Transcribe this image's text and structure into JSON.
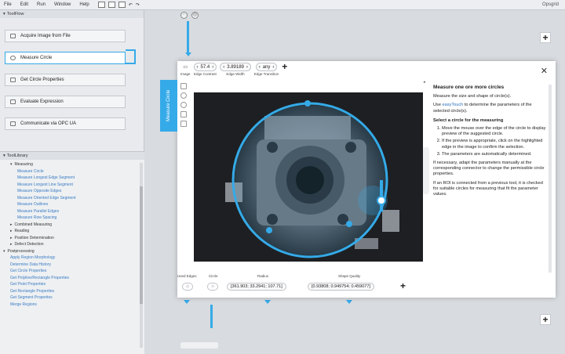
{
  "menu": {
    "items": [
      "File",
      "Edit",
      "Run",
      "Window",
      "Help"
    ],
    "brand": "Opsgrid"
  },
  "toolflow": {
    "title": "ToolFlow",
    "steps": [
      "Acquire Image from File",
      "Measure Circle",
      "Get Circle Properties",
      "Evaluate Expression",
      "Communicate via OPC UA"
    ]
  },
  "toollib": {
    "title": "ToolLibrary",
    "items": [
      {
        "label": "Measuring",
        "level": 1,
        "expander": "▾",
        "link": false
      },
      {
        "label": "Measure Circle",
        "level": 2,
        "link": true
      },
      {
        "label": "Measure Longest Edge Segment",
        "level": 2,
        "link": true
      },
      {
        "label": "Measure Longest Line Segment",
        "level": 2,
        "link": true
      },
      {
        "label": "Measure Opposite Edges",
        "level": 2,
        "link": true
      },
      {
        "label": "Measure Oriented Edge Segment",
        "level": 2,
        "link": true
      },
      {
        "label": "Measure Outlines",
        "level": 2,
        "link": true
      },
      {
        "label": "Measure Parallel Edges",
        "level": 2,
        "link": true
      },
      {
        "label": "Measure Row Spacing",
        "level": 2,
        "link": true
      },
      {
        "label": "Combined Measuring",
        "level": 1,
        "expander": "▸",
        "link": false
      },
      {
        "label": "Reading",
        "level": 1,
        "expander": "▸",
        "link": false
      },
      {
        "label": "Position Determination",
        "level": 1,
        "expander": "▸",
        "link": false
      },
      {
        "label": "Defect Detection",
        "level": 1,
        "expander": "▸",
        "link": false
      },
      {
        "label": "Postprocessing",
        "level": 0,
        "expander": "▾",
        "link": false
      },
      {
        "label": "Apply Region Morphology",
        "level": 1,
        "link": true
      },
      {
        "label": "Determine Data History",
        "level": 1,
        "link": true
      },
      {
        "label": "Get Circle Properties",
        "level": 1,
        "link": true
      },
      {
        "label": "Get Polyline/Rectangle Properties",
        "level": 1,
        "link": true
      },
      {
        "label": "Get Point Properties",
        "level": 1,
        "link": true
      },
      {
        "label": "Get Rectangle Properties",
        "level": 1,
        "link": true
      },
      {
        "label": "Get Segment Properties",
        "level": 1,
        "link": true
      },
      {
        "label": "Merge Regions",
        "level": 1,
        "link": true
      }
    ]
  },
  "dialog": {
    "side_tab": "Measure Circle",
    "params": [
      {
        "value": "57.4",
        "label": "Edge Contrast"
      },
      {
        "value": "3.89189",
        "label": "Edge Width"
      },
      {
        "value": "any",
        "label": "Edge Transition"
      }
    ],
    "image_label": "Image",
    "help": {
      "title": "Measure one ore more circles",
      "p1": "Measure the size and shape of circle(s).",
      "p2_pre": "Use ",
      "p2_link": "easyTouch",
      "p2_post": " to determine the parameters of the selected circle(s).",
      "subtitle": "Select a circle for the measuring",
      "steps": [
        "Move the mouse over the edge of the circle to display preview of the suggested circle.",
        "If the preview is appropriate, click on the highlighted edge in the image to confirm the selection.",
        "The parameters are automatically determined."
      ],
      "p3": "If necessary, adapt the parameters manually at the corresponding connector to change the permissible circle properties.",
      "p4": "If an ROI is connected from a previous tool, it is checked for suitable circles for measuring that fit the parameter values."
    },
    "bottom": {
      "labels": [
        "Used Edges",
        "Circle",
        "Radius",
        "Shape Quality"
      ],
      "radius_value": "[361.903; 33.2941; 107.71]",
      "quality_value": "[0.93808; 0.949754; 0.459077]"
    }
  }
}
